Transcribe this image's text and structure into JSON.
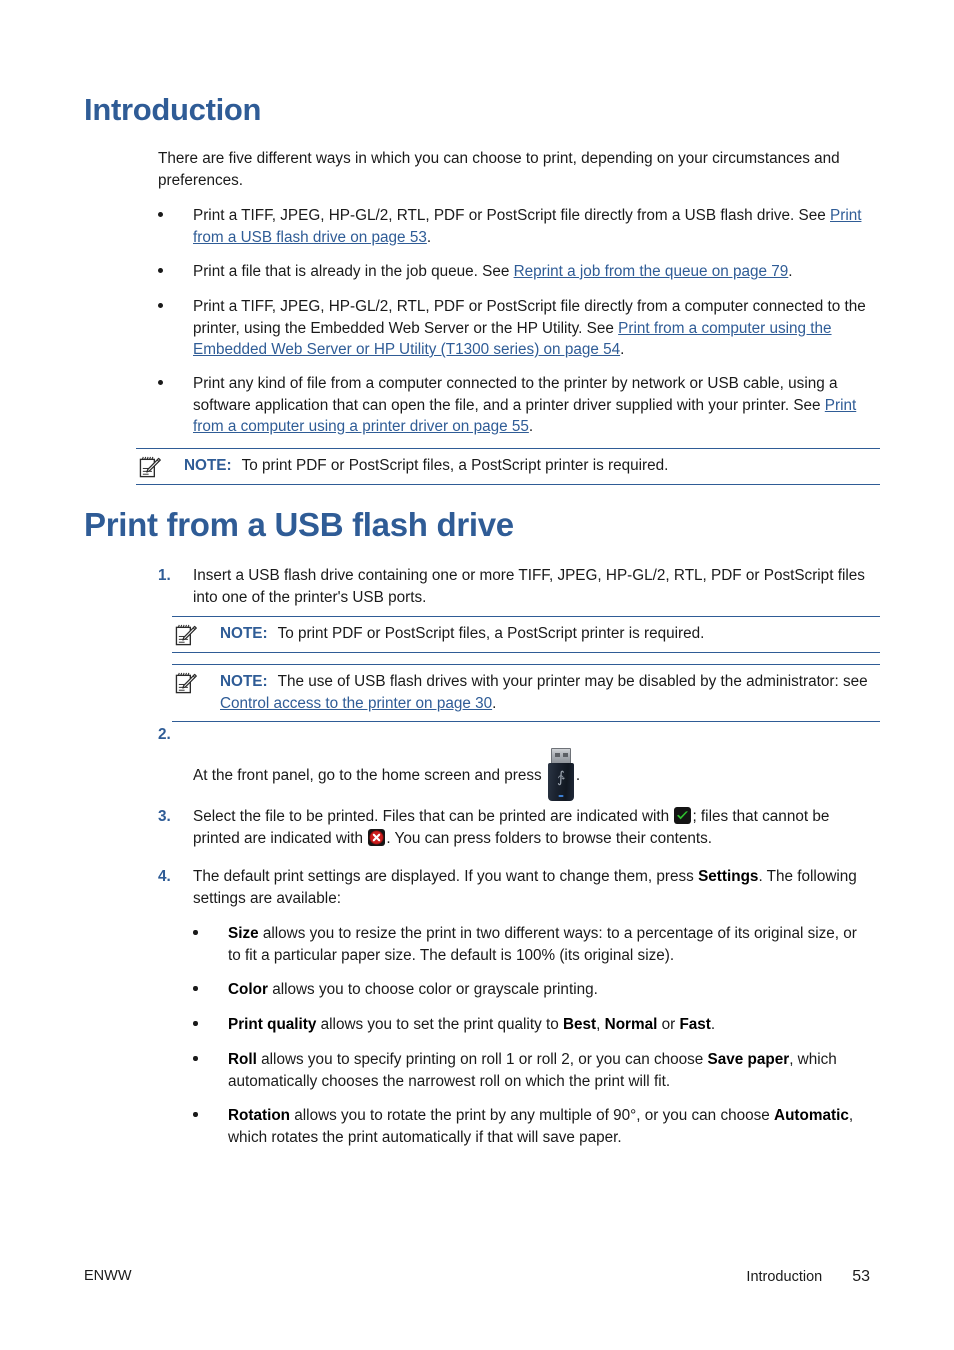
{
  "document": {
    "section_heading": "Introduction",
    "second_heading": "Print from a USB flash drive"
  },
  "intro": {
    "paragraph": "There are five different ways in which you can choose to print, depending on your circumstances and preferences.",
    "bullets": [
      {
        "text_before": "Print a TIFF, JPEG, HP-GL/2, RTL, PDF or PostScript file directly from a USB flash drive. See ",
        "link": "Print from a USB flash drive on page 53",
        "text_after": "."
      },
      {
        "text_before": "Print a file that is already in the job queue. See ",
        "link": "Reprint a job from the queue on page 79",
        "text_after": "."
      },
      {
        "text_before": "Print a TIFF, JPEG, HP-GL/2, RTL, PDF or PostScript file directly from a computer connected to the printer, using the Embedded Web Server or the HP Utility. See ",
        "link": "Print from a computer using the Embedded Web Server or HP Utility (T1300 series) on page 54",
        "text_after": "."
      },
      {
        "text_before": "Print any kind of file from a computer connected to the printer by network or USB cable, using a software application that can open the file, and a printer driver supplied with your printer. See ",
        "link": "Print from a computer using a printer driver on page 55",
        "text_after": "."
      }
    ],
    "note": {
      "label": "NOTE:",
      "body": "To print PDF or PostScript files, a PostScript printer is required."
    }
  },
  "usb_section": {
    "steps": {
      "step1": {
        "number": "1.",
        "text": "Insert a USB flash drive containing one or more TIFF, JPEG, HP-GL/2, RTL, PDF or PostScript files into one of the printer's USB ports."
      },
      "step2": {
        "number": "2.",
        "text": "At the front panel, go to the home screen and press",
        "text_after": "."
      },
      "step3": {
        "number": "3.",
        "text_a": "Select the file to be printed. Files that can be printed are indicated with",
        "text_b": "; files that cannot be printed are indicated with",
        "text_c": ". You can press folders to browse their contents."
      },
      "step4": {
        "number": "4.",
        "text_a": "The default print settings are displayed. If you want to change them, press ",
        "bold": "Settings",
        "text_b": ". The following settings are available:"
      }
    },
    "note1": {
      "label": "NOTE:",
      "body": "To print PDF or PostScript files, a PostScript printer is required."
    },
    "note2": {
      "label": "NOTE:",
      "text_before": "The use of USB flash drives with your printer may be disabled by the administrator: see ",
      "link": "Control access to the printer on page 30",
      "text_after": "."
    },
    "settings": [
      {
        "term": "Size",
        "rest": " allows you to resize the print in two different ways: to a percentage of its original size, or to fit a particular paper size. The default is 100% (its original size)."
      },
      {
        "term": "Color",
        "rest": " allows you to choose color or grayscale printing."
      },
      {
        "term": "Print quality",
        "rest_a": " allows you to set the print quality to ",
        "bold_a": "Best",
        "rest_b": ", ",
        "bold_b": "Normal",
        "rest_c": " or ",
        "bold_c": "Fast",
        "rest_d": "."
      },
      {
        "term": "Roll",
        "rest_a": " allows you to specify printing on roll 1 or roll 2, or you can choose ",
        "bold_a": "Save paper",
        "rest_b": ", which automatically chooses the narrowest roll on which the print will fit."
      },
      {
        "term": "Rotation",
        "rest_a": " allows you to rotate the print by any multiple of 90°, or you can choose ",
        "bold_a": "Automatic",
        "rest_b": ", which rotates the print automatically if that will save paper."
      }
    ]
  },
  "icons": {
    "note_icon": "notepad-pencil-icon",
    "usb_drive": "usb-flash-drive-icon",
    "printable": "green-check-icon",
    "not_printable": "red-cross-icon"
  },
  "footer": {
    "left": "ENWW",
    "section": "Introduction",
    "page": "53"
  },
  "colors": {
    "heading": "#2f5c96",
    "link": "#2f5c96",
    "check_green": "#2bc02b",
    "cross_red": "#cc1e1e"
  }
}
